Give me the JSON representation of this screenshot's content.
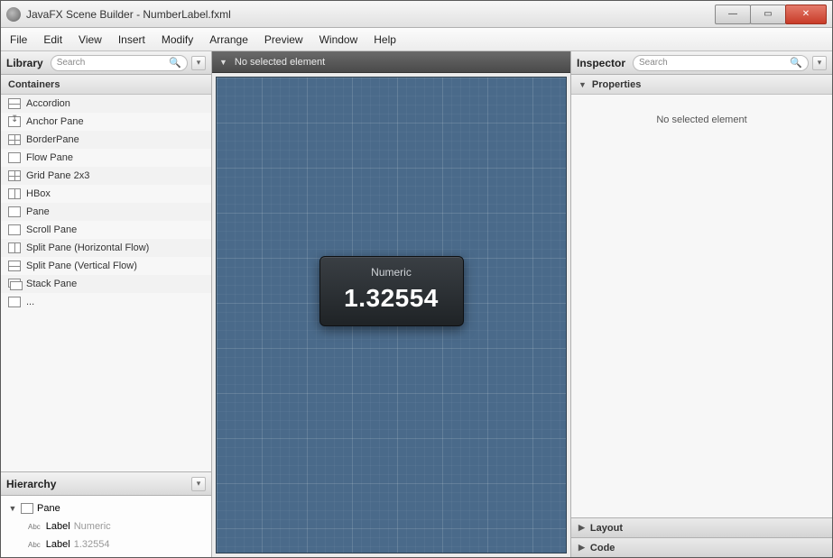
{
  "window": {
    "title": "JavaFX Scene Builder - NumberLabel.fxml"
  },
  "menu": [
    "File",
    "Edit",
    "View",
    "Insert",
    "Modify",
    "Arrange",
    "Preview",
    "Window",
    "Help"
  ],
  "library": {
    "title": "Library",
    "search_placeholder": "Search",
    "section": "Containers",
    "items": [
      "Accordion",
      "Anchor Pane",
      "BorderPane",
      "Flow Pane",
      "Grid Pane 2x3",
      "HBox",
      "Pane",
      "Scroll Pane",
      "Split Pane (Horizontal Flow)",
      "Split Pane (Vertical Flow)",
      "Stack Pane"
    ]
  },
  "hierarchy": {
    "title": "Hierarchy",
    "root": {
      "type": "Pane",
      "label": "Pane"
    },
    "children": [
      {
        "kind": "Abc",
        "type": "Label",
        "value": "Numeric"
      },
      {
        "kind": "Abc",
        "type": "Label",
        "value": "1.32554"
      }
    ]
  },
  "canvas": {
    "status": "No selected element",
    "widget": {
      "title": "Numeric",
      "value": "1.32554"
    }
  },
  "inspector": {
    "title": "Inspector",
    "search_placeholder": "Search",
    "sections": {
      "properties": "Properties",
      "layout": "Layout",
      "code": "Code"
    },
    "empty": "No selected element"
  }
}
